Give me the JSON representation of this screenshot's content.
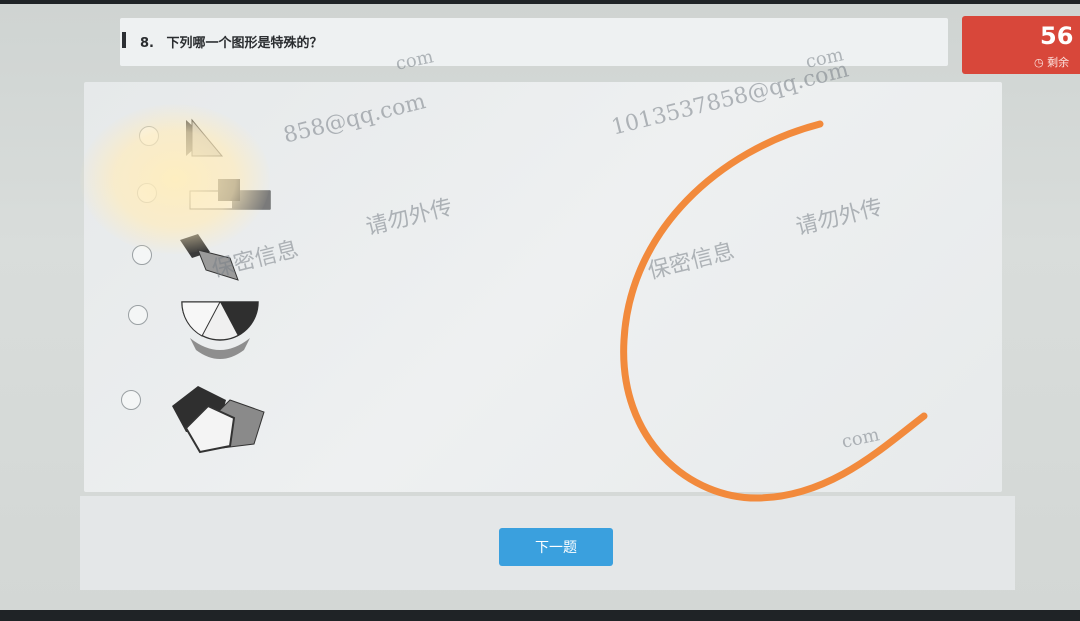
{
  "question": {
    "number": "8.",
    "text": "下列哪一个图形是特殊的？"
  },
  "timer": {
    "value": "56",
    "label": "剩余"
  },
  "options": [
    {
      "id": "A",
      "icon": "bowtie-triangle-figure"
    },
    {
      "id": "B",
      "icon": "overlapping-rectangles-figure"
    },
    {
      "id": "C",
      "icon": "rotated-parallelograms-figure"
    },
    {
      "id": "D",
      "icon": "semicircle-segments-figure"
    },
    {
      "id": "E",
      "icon": "overlapping-pentagons-figure"
    }
  ],
  "next_button": {
    "label": "下一题"
  },
  "watermarks": {
    "line1": "858@qq.com",
    "line2": "1013537858@qq.com",
    "line3": "保密信息",
    "line4": "请勿外传",
    "line5": "com"
  },
  "colors": {
    "timer_bg": "#d8473a",
    "button_bg": "#3aa0de",
    "annotation_stroke": "#f28a3c"
  }
}
